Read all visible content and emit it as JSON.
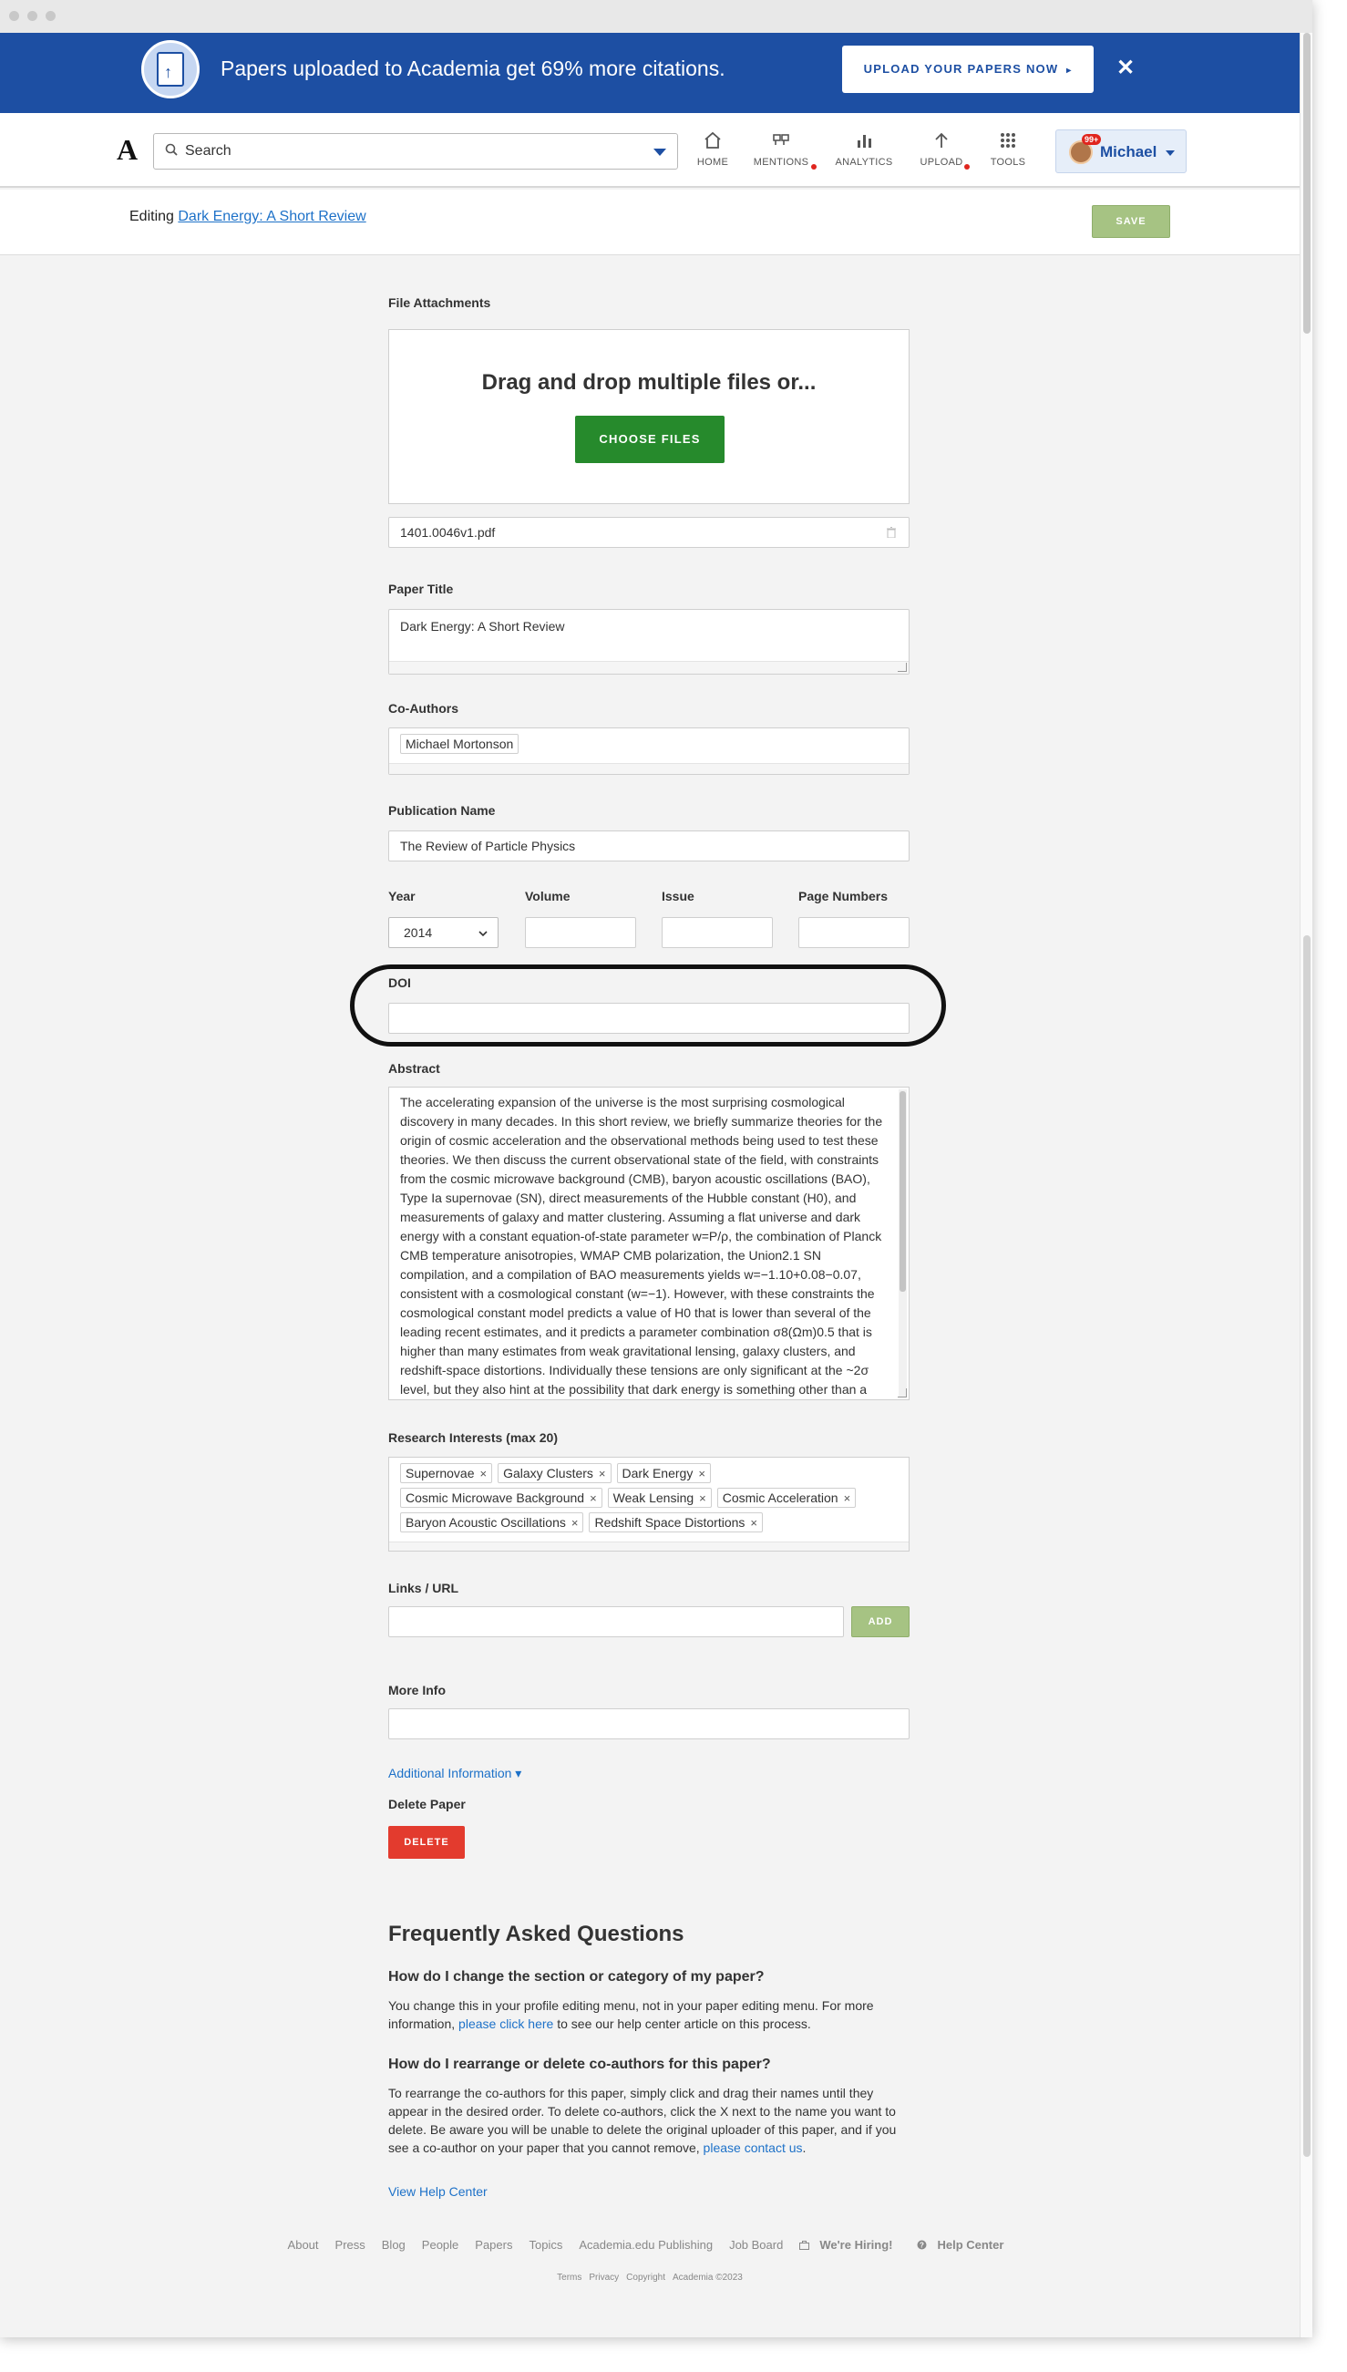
{
  "banner": {
    "message": "Papers uploaded to Academia get 69% more citations.",
    "cta_label": "UPLOAD YOUR PAPERS NOW",
    "cta_arrow": "▸",
    "close_glyph": "✕",
    "accent": "#1d4fa3"
  },
  "navbar": {
    "logo": "A",
    "search_placeholder": "Search",
    "items": [
      {
        "label": "HOME",
        "icon": "home-icon"
      },
      {
        "label": "MENTIONS",
        "icon": "mentions-icon"
      },
      {
        "label": "ANALYTICS",
        "icon": "analytics-icon"
      },
      {
        "label": "UPLOAD",
        "icon": "upload-icon"
      },
      {
        "label": "TOOLS",
        "icon": "tools-icon"
      }
    ],
    "user": {
      "name": "Michael",
      "badge": "99+"
    }
  },
  "editbar": {
    "prefix": "Editing",
    "paper_link": "Dark Energy: A Short Review",
    "save_label": "SAVE"
  },
  "form": {
    "file_attachments": {
      "label": "File Attachments",
      "dropzone_text": "Drag and drop multiple files or...",
      "choose_label": "CHOOSE FILES",
      "file_name": "1401.0046v1.pdf"
    },
    "paper_title": {
      "label": "Paper Title",
      "value": "Dark Energy: A Short Review"
    },
    "co_authors": {
      "label": "Co-Authors",
      "values": [
        "Michael Mortonson"
      ]
    },
    "publication_name": {
      "label": "Publication Name",
      "value": "The Review of Particle Physics"
    },
    "year": {
      "label": "Year",
      "value": "2014"
    },
    "volume": {
      "label": "Volume",
      "value": ""
    },
    "issue": {
      "label": "Issue",
      "value": ""
    },
    "page_numbers": {
      "label": "Page Numbers",
      "value": ""
    },
    "doi": {
      "label": "DOI",
      "value": ""
    },
    "abstract": {
      "label": "Abstract",
      "value": "The accelerating expansion of the universe is the most surprising cosmological discovery in many decades. In this short review, we briefly summarize theories for the origin of cosmic acceleration and the observational methods being used to test these theories. We then discuss the current observational state of the field, with constraints from the cosmic microwave background (CMB), baryon acoustic oscillations (BAO), Type Ia supernovae (SN), direct measurements of the Hubble constant (H0), and measurements of galaxy and matter clustering. Assuming a flat universe and dark energy with a constant equation-of-state parameter w=P/ρ, the combination of Planck CMB temperature anisotropies, WMAP CMB polarization, the Union2.1 SN compilation, and a compilation of BAO measurements yields w=−1.10+0.08−0.07, consistent with a cosmological constant (w=−1). However, with these constraints the cosmological constant model predicts a value of H0 that is lower than several of the leading recent estimates, and it predicts a parameter combination σ8(Ωm)0.5 that is higher than many estimates from weak gravitational lensing, galaxy clusters, and redshift-space distortions. Individually these tensions are only significant at the ~2σ level, but they also hint at the possibility that dark energy is something other than a cosmological constant."
    },
    "research_interests": {
      "label": "Research Interests (max 20)",
      "rows": [
        [
          "Supernovae",
          "Galaxy Clusters",
          "Dark Energy"
        ],
        [
          "Cosmic Microwave Background",
          "Weak Lensing",
          "Cosmic Acceleration"
        ],
        [
          "Baryon Acoustic Oscillations",
          "Redshift Space Distortions"
        ]
      ],
      "remove_glyph": "×"
    },
    "links": {
      "label": "Links / URL",
      "value": "",
      "add_label": "ADD"
    },
    "more_info": {
      "label": "More Info",
      "value": ""
    },
    "additional_info": "Additional Information ▾",
    "delete": {
      "label": "Delete Paper",
      "button": "DELETE"
    }
  },
  "faq": {
    "title": "Frequently Asked Questions",
    "q1": "How do I change the section or category of my paper?",
    "a1_pre": "You change this in your profile editing menu, not in your paper editing menu. For more information, ",
    "a1_link": "please click here",
    "a1_post": " to see our help center article on this process.",
    "q2": "How do I rearrange or delete co-authors for this paper?",
    "a2_pre": "To rearrange the co-authors for this paper, simply click and drag their names until they appear in the desired order. To delete co-authors, click the X next to the name you want to delete. Be aware you will be unable to delete the original uploader of this paper, and if you see a co-author on your paper that you cannot remove, ",
    "a2_link": "please contact us",
    "a2_post": ".",
    "help_center": "View Help Center"
  },
  "footer": {
    "links": [
      "About",
      "Press",
      "Blog",
      "People",
      "Papers",
      "Topics",
      "Academia.edu Publishing",
      "Job Board"
    ],
    "hiring": "We're Hiring!",
    "help": "Help Center",
    "legal": [
      "Terms",
      "Privacy",
      "Copyright",
      "Academia ©2023"
    ]
  }
}
